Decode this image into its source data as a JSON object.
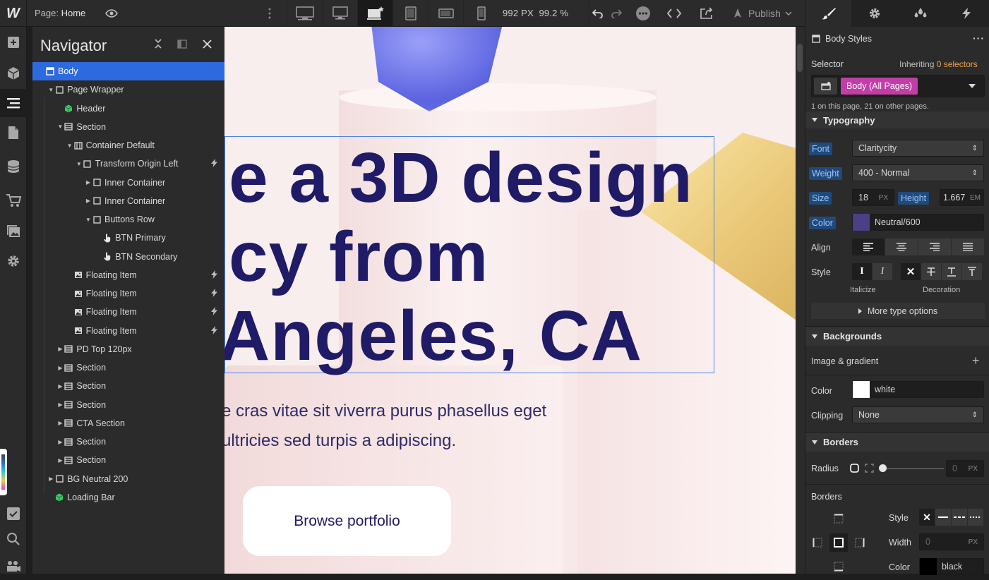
{
  "topbar": {
    "logo": "W",
    "page_prefix": "Page:",
    "page_name": "Home",
    "viewport_width": "992 PX",
    "zoom": "99.2 %",
    "publish_label": "Publish"
  },
  "navigator": {
    "title": "Navigator",
    "items": [
      {
        "label": "Body",
        "depth": 0,
        "icon": "body-icon",
        "caret": "",
        "selected": true,
        "bolt": false
      },
      {
        "label": "Page Wrapper",
        "depth": 1,
        "icon": "box-icon",
        "caret": "down",
        "selected": false,
        "bolt": false
      },
      {
        "label": "Header",
        "depth": 2,
        "icon": "component-icon",
        "caret": "",
        "selected": false,
        "bolt": false
      },
      {
        "label": "Section",
        "depth": 2,
        "icon": "section-icon",
        "caret": "down",
        "selected": false,
        "bolt": false
      },
      {
        "label": "Container Default",
        "depth": 3,
        "icon": "container-icon",
        "caret": "down",
        "selected": false,
        "bolt": false
      },
      {
        "label": "Transform Origin Left",
        "depth": 4,
        "icon": "box-icon",
        "caret": "down",
        "selected": false,
        "bolt": true
      },
      {
        "label": "Inner Container",
        "depth": 5,
        "icon": "box-icon",
        "caret": "right",
        "selected": false,
        "bolt": false
      },
      {
        "label": "Inner Container",
        "depth": 5,
        "icon": "box-icon",
        "caret": "right",
        "selected": false,
        "bolt": false
      },
      {
        "label": "Buttons Row",
        "depth": 5,
        "icon": "box-icon",
        "caret": "down",
        "selected": false,
        "bolt": false
      },
      {
        "label": "BTN Primary",
        "depth": 6,
        "icon": "hand-icon",
        "caret": "",
        "selected": false,
        "bolt": false
      },
      {
        "label": "BTN Secondary",
        "depth": 6,
        "icon": "hand-icon",
        "caret": "",
        "selected": false,
        "bolt": false
      },
      {
        "label": "Floating Item",
        "depth": 3,
        "icon": "image-icon",
        "caret": "",
        "selected": false,
        "bolt": true
      },
      {
        "label": "Floating Item",
        "depth": 3,
        "icon": "image-icon",
        "caret": "",
        "selected": false,
        "bolt": true
      },
      {
        "label": "Floating Item",
        "depth": 3,
        "icon": "image-icon",
        "caret": "",
        "selected": false,
        "bolt": true
      },
      {
        "label": "Floating Item",
        "depth": 3,
        "icon": "image-icon",
        "caret": "",
        "selected": false,
        "bolt": true
      },
      {
        "label": "PD Top 120px",
        "depth": 2,
        "icon": "section-icon",
        "caret": "right",
        "selected": false,
        "bolt": false
      },
      {
        "label": "Section",
        "depth": 2,
        "icon": "section-icon",
        "caret": "right",
        "selected": false,
        "bolt": false
      },
      {
        "label": "Section",
        "depth": 2,
        "icon": "section-icon",
        "caret": "right",
        "selected": false,
        "bolt": false
      },
      {
        "label": "Section",
        "depth": 2,
        "icon": "section-icon",
        "caret": "right",
        "selected": false,
        "bolt": false
      },
      {
        "label": "CTA Section",
        "depth": 2,
        "icon": "section-icon",
        "caret": "right",
        "selected": false,
        "bolt": false
      },
      {
        "label": "Section",
        "depth": 2,
        "icon": "section-icon",
        "caret": "right",
        "selected": false,
        "bolt": false
      },
      {
        "label": "Section",
        "depth": 2,
        "icon": "section-icon",
        "caret": "right",
        "selected": false,
        "bolt": false
      },
      {
        "label": "BG Neutral 200",
        "depth": 1,
        "icon": "box-icon",
        "caret": "right",
        "selected": false,
        "bolt": false
      },
      {
        "label": "Loading Bar",
        "depth": 1,
        "icon": "component-icon",
        "caret": "",
        "selected": false,
        "bolt": false
      }
    ]
  },
  "canvas": {
    "heading_lines": [
      "e a 3D design",
      "cy from",
      "Angeles, CA"
    ],
    "paragraph_lines": [
      "e cras vitae sit viverra purus phasellus eget",
      "ultricies sed turpis a adipiscing."
    ],
    "button_label": "Browse portfolio",
    "heading_color": "#1f1b66"
  },
  "style_panel": {
    "header_title": "Body Styles",
    "selector_label": "Selector",
    "inheriting_prefix": "Inheriting",
    "inheriting_count": "0 selectors",
    "selector_tag": "Body (All Pages)",
    "selector_info": "1 on this page, 21 on other pages.",
    "typography": {
      "title": "Typography",
      "font_label": "Font",
      "font_value": "Claritycity",
      "weight_label": "Weight",
      "weight_value": "400 - Normal",
      "size_label": "Size",
      "size_value": "18",
      "size_unit": "PX",
      "height_label": "Height",
      "height_value": "1.667",
      "height_unit": "EM",
      "color_label": "Color",
      "color_value": "Neutral/600",
      "color_swatch": "#4b3f86",
      "align_label": "Align",
      "style_label": "Style",
      "italicize_label": "Italicize",
      "decoration_label": "Decoration",
      "more_label": "More type options"
    },
    "backgrounds": {
      "title": "Backgrounds",
      "image_gradient_label": "Image & gradient",
      "color_label": "Color",
      "color_value": "white",
      "clipping_label": "Clipping",
      "clipping_value": "None"
    },
    "borders": {
      "title": "Borders",
      "radius_label": "Radius",
      "radius_value": "0",
      "radius_unit": "PX",
      "borders_label": "Borders",
      "style_label": "Style",
      "width_label": "Width",
      "width_value": "0",
      "width_unit": "PX",
      "color_label": "Color",
      "color_value": "black"
    }
  }
}
